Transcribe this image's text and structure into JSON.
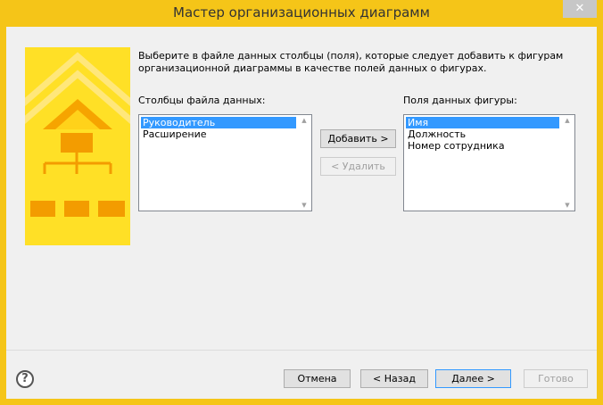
{
  "window": {
    "title": "Мастер организационных диаграмм",
    "close_glyph": "✕"
  },
  "instructions": "Выберите в файле данных столбцы (поля), которые следует добавить к фигурам организационной диаграммы в качестве полей данных о фигурах.",
  "left_list": {
    "label": "Столбцы файла данных:",
    "items": [
      "Руководитель",
      "Расширение"
    ],
    "selected_index": 0
  },
  "right_list": {
    "label": "Поля данных фигуры:",
    "items": [
      "Имя",
      "Должность",
      "Номер сотрудника"
    ],
    "selected_index": 0
  },
  "buttons": {
    "add": "Добавить >",
    "remove": "< Удалить",
    "cancel": "Отмена",
    "back": "< Назад",
    "next": "Далее >",
    "finish": "Готово"
  },
  "icons": {
    "help": "help-icon",
    "close": "close-icon",
    "illustration": "org-chart-illustration"
  },
  "colors": {
    "accent": "#f5c518",
    "selection": "#3399ff",
    "client_bg": "#f0f0f0"
  }
}
